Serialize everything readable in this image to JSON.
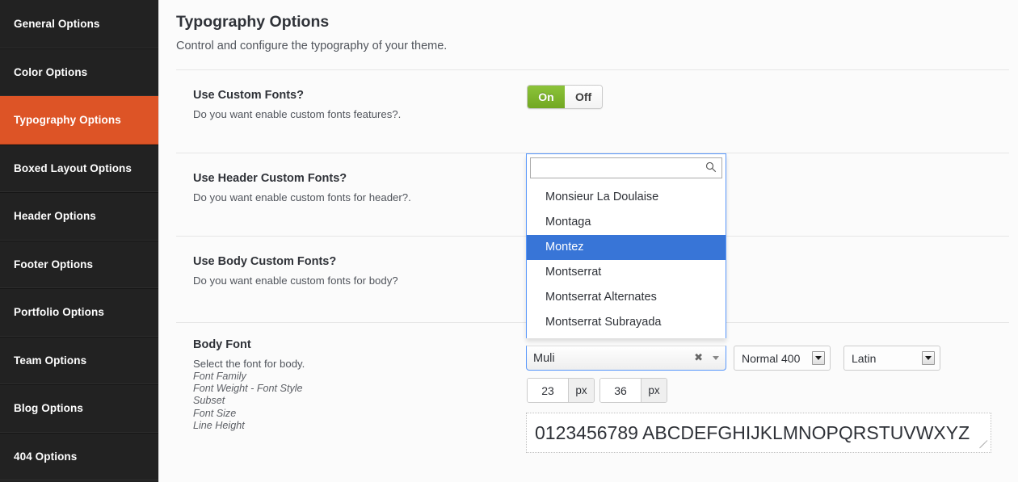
{
  "sidebar": {
    "items": [
      {
        "label": "General Options",
        "active": false
      },
      {
        "label": "Color Options",
        "active": false
      },
      {
        "label": "Typography Options",
        "active": true
      },
      {
        "label": "Boxed Layout Options",
        "active": false
      },
      {
        "label": "Header Options",
        "active": false
      },
      {
        "label": "Footer Options",
        "active": false
      },
      {
        "label": "Portfolio Options",
        "active": false
      },
      {
        "label": "Team Options",
        "active": false
      },
      {
        "label": "Blog Options",
        "active": false
      },
      {
        "label": "404 Options",
        "active": false
      }
    ]
  },
  "page": {
    "title": "Typography Options",
    "subtitle": "Control and configure the typography of your theme."
  },
  "sections": {
    "custom_fonts": {
      "title": "Use Custom Fonts?",
      "description": "Do you want enable custom fonts features?.",
      "toggle": {
        "on_label": "On",
        "off_label": "Off",
        "value": "On"
      }
    },
    "header_fonts": {
      "title": "Use Header Custom Fonts?",
      "description": "Do you want enable custom fonts for header?."
    },
    "body_fonts": {
      "title": "Use Body Custom Fonts?",
      "description": "Do you want enable custom fonts for body?"
    },
    "body_font": {
      "title": "Body Font",
      "description": "Select the font for body.",
      "sub_labels": [
        "Font Family",
        "Font Weight - Font Style",
        "Subset",
        "Font Size",
        "Line Height"
      ]
    }
  },
  "font_dropdown": {
    "search_value": "",
    "search_placeholder": "",
    "search_icon": "search-icon",
    "options": [
      {
        "label": "Monsieur La Doulaise",
        "highlighted": false
      },
      {
        "label": "Montaga",
        "highlighted": false
      },
      {
        "label": "Montez",
        "highlighted": true
      },
      {
        "label": "Montserrat",
        "highlighted": false
      },
      {
        "label": "Montserrat Alternates",
        "highlighted": false
      },
      {
        "label": "Montserrat Subrayada",
        "highlighted": false
      }
    ],
    "highlight_color": "#3875d7",
    "border_color": "#5897fb"
  },
  "font_family_field": {
    "value": "Muli",
    "clear_icon": "✖",
    "caret_icon": "chevron-down-icon"
  },
  "font_weight_select": {
    "value": "Normal 400"
  },
  "subset_select": {
    "value": "Latin"
  },
  "font_size": {
    "value": "23",
    "unit": "px"
  },
  "line_height": {
    "value": "36",
    "unit": "px"
  },
  "preview": {
    "text": "0123456789 ABCDEFGHIJKLMNOPQRSTUVWXYZ"
  },
  "colors": {
    "sidebar_bg": "#222222",
    "sidebar_active": "#dd5426",
    "toggle_on": "#7fb42a",
    "dropdown_highlight": "#3875d7",
    "content_bg": "#fbfbfb"
  }
}
